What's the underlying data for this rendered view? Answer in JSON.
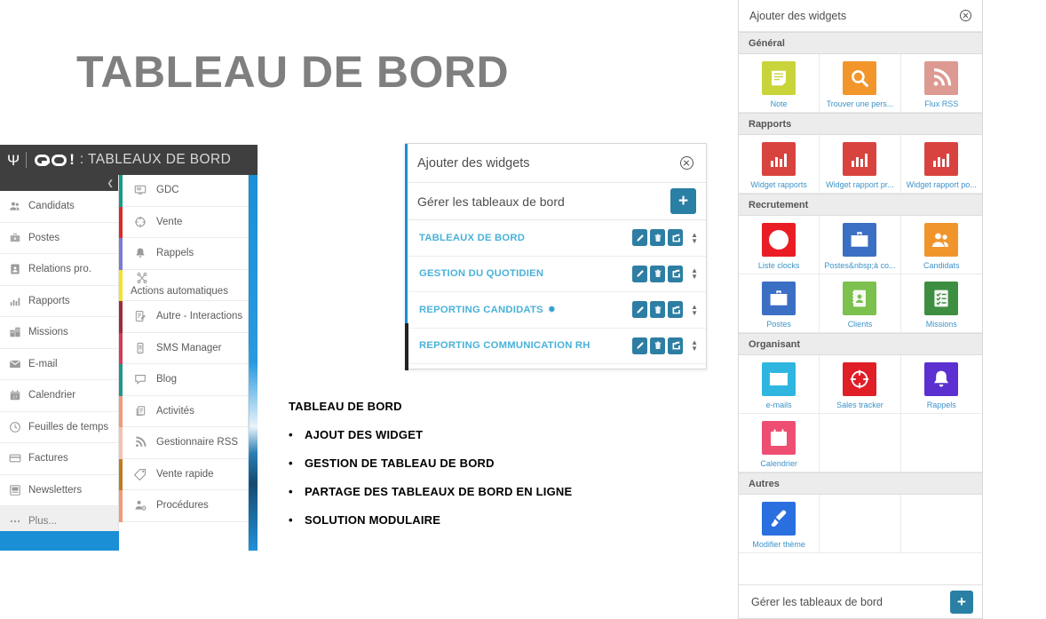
{
  "slide": {
    "title": "TABLEAU DE BORD"
  },
  "app": {
    "header": {
      "logo_symbol": "psi-icon",
      "brand": "GO!",
      "title": ": TABLEAUX DE BORD"
    },
    "nav_primary": [
      {
        "label": "Candidats",
        "icon": "users-icon"
      },
      {
        "label": "Postes",
        "icon": "briefcase-icon"
      },
      {
        "label": "Relations pro.",
        "icon": "contact-card-icon"
      },
      {
        "label": "Rapports",
        "icon": "bar-chart-icon"
      },
      {
        "label": "Missions",
        "icon": "buildings-icon"
      },
      {
        "label": "E-mail",
        "icon": "envelope-icon"
      },
      {
        "label": "Calendrier",
        "icon": "calendar-icon"
      },
      {
        "label": "Feuilles de temps",
        "icon": "clock-icon"
      },
      {
        "label": "Factures",
        "icon": "credit-card-icon"
      },
      {
        "label": "Newsletters",
        "icon": "newsletter-icon"
      },
      {
        "label": "Plus...",
        "icon": "ellipsis-icon",
        "selected": true
      }
    ],
    "nav_secondary": [
      {
        "label": "GDC",
        "icon": "monitor-icon",
        "stripe": "#179a8a"
      },
      {
        "label": "Vente",
        "icon": "target-icon",
        "stripe": "#d92b2b"
      },
      {
        "label": "Rappels",
        "icon": "bell-icon",
        "stripe": "#7a7ad8"
      },
      {
        "label": "Actions automatiques",
        "icon": "nodes-icon",
        "stripe": "#f2e229",
        "wrap": true
      },
      {
        "label": "Autre - Interactions",
        "icon": "note-edit-icon",
        "stripe": "#9c2b3e"
      },
      {
        "label": "SMS Manager",
        "icon": "mobile-icon",
        "stripe": "#d23c5c"
      },
      {
        "label": "Blog",
        "icon": "speech-bubble-icon",
        "stripe": "#1e968d"
      },
      {
        "label": "Activités",
        "icon": "pages-icon",
        "stripe": "#f09a7a"
      },
      {
        "label": "Gestionnaire RSS",
        "icon": "rss-icon",
        "stripe": "#f3c3ae"
      },
      {
        "label": "Vente rapide",
        "icon": "tag-icon",
        "stripe": "#c07a1e"
      },
      {
        "label": "Procédures",
        "icon": "person-gear-icon",
        "stripe": "#ef9a78"
      }
    ]
  },
  "dialog": {
    "title": "Ajouter des widgets",
    "close_icon": "close-circle-icon",
    "manage_label": "Gérer les tableaux de bord",
    "add_button_label": "+",
    "action_icons": [
      "pencil-icon",
      "trash-icon",
      "share-icon",
      "reorder-icon"
    ],
    "dashboards": [
      {
        "name": "TABLEAUX DE BORD",
        "starred": false
      },
      {
        "name": "GESTION DU QUOTIDIEN",
        "starred": false
      },
      {
        "name": "REPORTING CANDIDATS",
        "starred": true,
        "star": "✹"
      },
      {
        "name": "REPORTING COMMUNICATION RH",
        "starred": false
      }
    ]
  },
  "bullets": {
    "heading": "TABLEAU DE BORD",
    "marker": "•",
    "items": [
      "AJOUT DES WIDGET",
      "GESTION DE TABLEAU DE BORD",
      "PARTAGE DES TABLEAUX DE BORD EN LIGNE",
      "SOLUTION MODULAIRE"
    ]
  },
  "widget_panel": {
    "title": "Ajouter des widgets",
    "close_icon": "close-circle-icon",
    "footer_label": "Gérer les tableaux de bord",
    "footer_button_label": "+",
    "sections": [
      {
        "title": "Général",
        "widgets": [
          {
            "label": "Note",
            "icon": "note-icon",
            "color": "#c9d43a"
          },
          {
            "label": "Trouver une pers...",
            "icon": "search-icon",
            "color": "#f2962c"
          },
          {
            "label": "Flux RSS",
            "icon": "rss-icon",
            "color": "#dd9a92"
          }
        ]
      },
      {
        "title": "Rapports",
        "widgets": [
          {
            "label": "Widget rapports",
            "icon": "bar-chart-icon",
            "color": "#d8433f"
          },
          {
            "label": "Widget rapport pr...",
            "icon": "bar-chart-icon",
            "color": "#d8433f"
          },
          {
            "label": "Widget rapport po...",
            "icon": "bar-chart-icon",
            "color": "#d8433f"
          }
        ]
      },
      {
        "title": "Recrutement",
        "widgets": [
          {
            "label": "Liste clocks",
            "icon": "play-circle-icon",
            "color": "#ea1d24"
          },
          {
            "label": "Postes&nbsp;à co...",
            "icon": "briefcase-lock-icon",
            "color": "#3b6fc4"
          },
          {
            "label": "Candidats",
            "icon": "users-icon",
            "color": "#f0952c"
          },
          {
            "label": "Postes",
            "icon": "briefcase-lock-icon",
            "color": "#3b6fc4"
          },
          {
            "label": "Clients",
            "icon": "address-book-icon",
            "color": "#7cc04e"
          },
          {
            "label": "Missions",
            "icon": "checklist-icon",
            "color": "#3e8e41"
          }
        ]
      },
      {
        "title": "Organisant",
        "widgets": [
          {
            "label": "e-mails",
            "icon": "envelope-icon",
            "color": "#2eb6e0"
          },
          {
            "label": "Sales tracker",
            "icon": "target-icon",
            "color": "#e01e26"
          },
          {
            "label": "Rappels",
            "icon": "bell-icon",
            "color": "#5b2fd0"
          },
          {
            "label": "Calendrier",
            "icon": "calendar-icon",
            "color": "#ee4e72"
          }
        ]
      },
      {
        "title": "Autres",
        "widgets": [
          {
            "label": "Modifier thème",
            "icon": "paintbrush-icon",
            "color": "#2a6fe0"
          }
        ]
      }
    ]
  }
}
